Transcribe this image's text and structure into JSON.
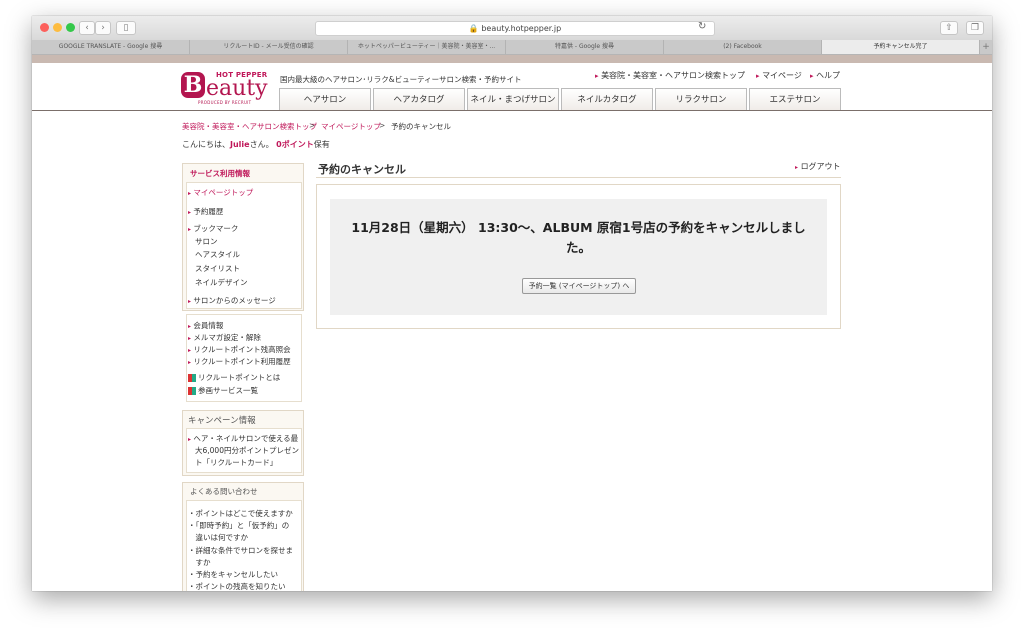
{
  "browser": {
    "url": "beauty.hotpepper.jp",
    "tabs": [
      {
        "label": "GOOGLE TRANSLATE - Google 搜尋",
        "active": false
      },
      {
        "label": "リクルートID - メール受信の確認",
        "active": false
      },
      {
        "label": "ホットペッパービューティー｜美容院・美容室・...",
        "active": false
      },
      {
        "label": "特嘉供 - Google 搜尋",
        "active": false
      },
      {
        "label": "(2) Facebook",
        "active": false
      },
      {
        "label": "予約キャンセル完了",
        "active": true
      }
    ],
    "new_tab": "+"
  },
  "header": {
    "logo_top": "HOT PEPPER",
    "logo_b": "B",
    "logo_rest": "eauty",
    "logo_byline": "PRODUCED BY RECRUIT",
    "tagline": "国内最大級のヘアサロン･リラク&ビューティーサロン検索・予約サイト",
    "links": [
      "美容院・美容室・ヘアサロン検索トップ",
      "マイページ",
      "ヘルプ"
    ],
    "nav": [
      "ヘアサロン",
      "ヘアカタログ",
      "ネイル・まつげサロン",
      "ネイルカタログ",
      "リラクサロン",
      "エステサロン"
    ]
  },
  "breadcrumb": {
    "items": [
      "美容院・美容室・ヘアサロン検索トップ",
      "マイページトップ",
      "予約のキャンセル"
    ],
    "sep": ">"
  },
  "greeting": {
    "prefix": "こんにちは、",
    "name": "Julie",
    "suffix": "さん。",
    "points": "0ポイント",
    "points_suffix": "保有"
  },
  "sidebar": {
    "service_title": "サービス利用情報",
    "service_items": [
      "マイページトップ",
      "予約履歴",
      "ブックマーク"
    ],
    "bookmark_subs": [
      "サロン",
      "ヘアスタイル",
      "スタイリスト",
      "ネイルデザイン"
    ],
    "messages": "サロンからのメッセージ",
    "member_items": [
      "会員情報",
      "メルマガ設定・解除",
      "リクルートポイント残高照会",
      "リクルートポイント利用履歴"
    ],
    "icon_items": [
      "リクルートポイントとは",
      "参画サービス一覧"
    ],
    "campaign_title": "キャンペーン情報",
    "campaign_lines": [
      "ヘア・ネイルサロンで使える最",
      "大6,000円分ポイントプレゼン",
      "ト「リクルートカード」"
    ],
    "faq_title": "よくある問い合わせ",
    "faq_lines": [
      "・ポイントはどこで使えますか",
      "・「即時予約」と「仮予約」の",
      "　違いは何ですか",
      "・詳細な条件でサロンを探せま",
      "　すか",
      "・予約をキャンセルしたい",
      "・ポイントの残高を知りたい"
    ]
  },
  "main": {
    "title": "予約のキャンセル",
    "logout": "ログアウト",
    "message_line1": "11月28日（星期六） 13:30～、ALBUM 原宿1号店の予約をキャンセルしまし",
    "message_line2": "た。",
    "button": "予約一覧 (マイページトップ) へ"
  },
  "colors": {
    "brand": "#b3154f",
    "link": "#c0185a",
    "panel": "#f0f0f0"
  }
}
